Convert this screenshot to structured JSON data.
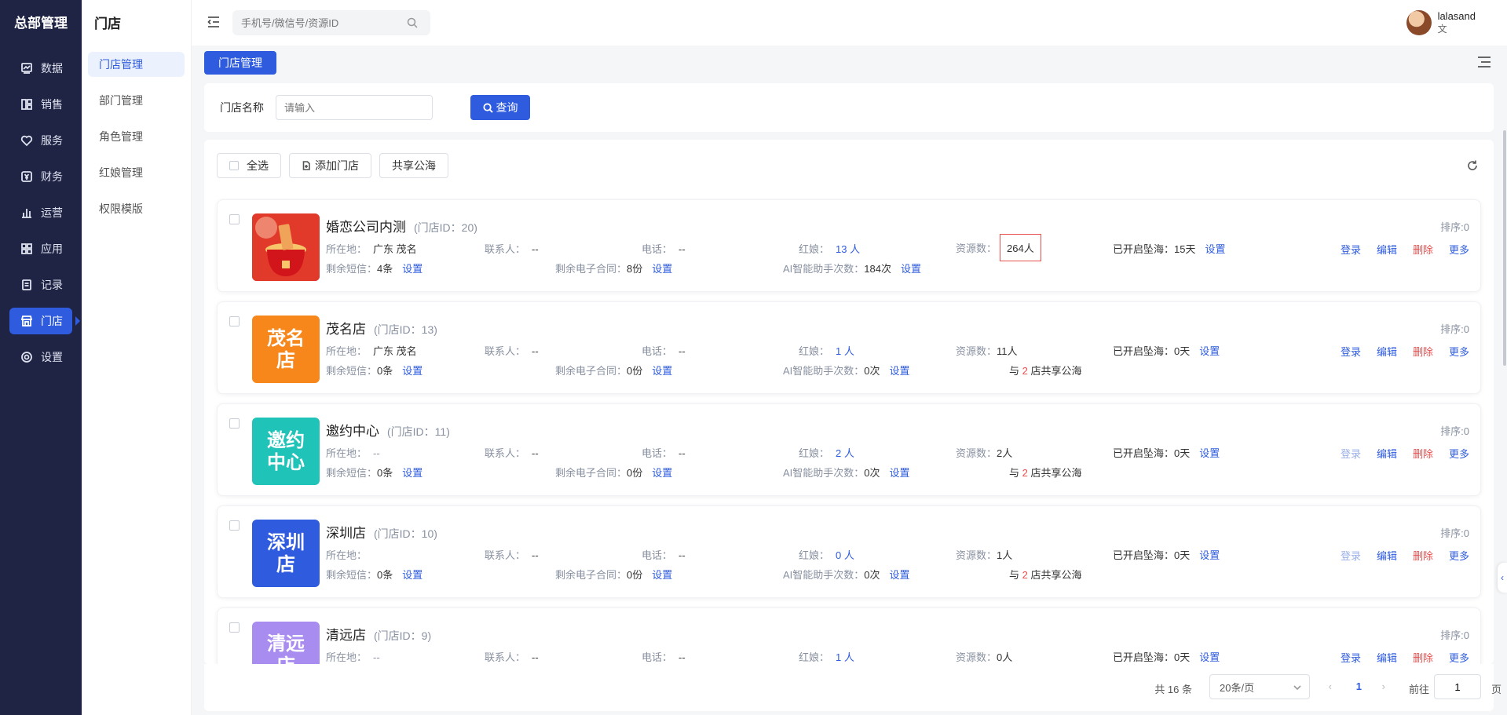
{
  "sidebar": {
    "brand": "总部管理",
    "items": [
      {
        "label": "数据"
      },
      {
        "label": "销售"
      },
      {
        "label": "服务"
      },
      {
        "label": "财务"
      },
      {
        "label": "运营"
      },
      {
        "label": "应用"
      },
      {
        "label": "记录"
      },
      {
        "label": "门店"
      },
      {
        "label": "设置"
      }
    ]
  },
  "submenu": {
    "title": "门店",
    "items": [
      {
        "label": "门店管理"
      },
      {
        "label": "部门管理"
      },
      {
        "label": "角色管理"
      },
      {
        "label": "红娘管理"
      },
      {
        "label": "权限模版"
      }
    ]
  },
  "header": {
    "search_placeholder": "手机号/微信号/资源ID",
    "user_name": "lalasand",
    "user_role": "文"
  },
  "tab": {
    "label": "门店管理"
  },
  "filter": {
    "name_label": "门店名称",
    "name_placeholder": "请输入",
    "query_label": "查询"
  },
  "toolbar": {
    "select_all": "全选",
    "add_store": "添加门店",
    "shared_pool": "共享公海"
  },
  "labels": {
    "id_prefix": "(门店ID：",
    "id_suffix": ")",
    "sort": "排序:0",
    "location": "所在地：",
    "contact": "联系人：",
    "phone": "电话：",
    "matchmaker": "红娘：",
    "resources": "资源数：",
    "pool_open": "已开启坠海：",
    "sms": "剩余短信：",
    "contracts": "剩余电子合同：",
    "ai": "AI智能助手次数：",
    "set": "设置",
    "share_prefix": "与",
    "share_suffix": "店共享公海",
    "login": "登录",
    "edit": "编辑",
    "delete": "删除",
    "more": "更多"
  },
  "stores": [
    {
      "name": "婚恋公司内测",
      "id": "20",
      "location": "广东    茂名",
      "contact": "--",
      "phone": "--",
      "matchmaker": "13 人",
      "resources": "264人",
      "pool_days": "15天",
      "sms": "4条",
      "contracts": "8份",
      "ai": "184次",
      "share_count": "",
      "logo_text": ""
    },
    {
      "name": "茂名店",
      "id": "13",
      "location": "广东    茂名",
      "contact": "--",
      "phone": "--",
      "matchmaker": "1 人",
      "resources": "11人",
      "pool_days": "0天",
      "sms": "0条",
      "contracts": "0份",
      "ai": "0次",
      "share_count": "2",
      "logo_text": "茂名店"
    },
    {
      "name": "邀约中心",
      "id": "11",
      "location": "--",
      "contact": "--",
      "phone": "--",
      "matchmaker": "2 人",
      "resources": "2人",
      "pool_days": "0天",
      "sms": "0条",
      "contracts": "0份",
      "ai": "0次",
      "share_count": "2",
      "logo_text": "邀约中心"
    },
    {
      "name": "深圳店",
      "id": "10",
      "location": "",
      "contact": "--",
      "phone": "--",
      "matchmaker": "0 人",
      "resources": "1人",
      "pool_days": "0天",
      "sms": "0条",
      "contracts": "0份",
      "ai": "0次",
      "share_count": "2",
      "logo_text": "深圳店"
    },
    {
      "name": "清远店",
      "id": "9",
      "location": "--",
      "contact": "--",
      "phone": "--",
      "matchmaker": "1 人",
      "resources": "0人",
      "pool_days": "0天",
      "sms": "",
      "contracts": "",
      "ai": "",
      "share_count": "",
      "logo_text": "清远店"
    }
  ],
  "colors": {
    "accent": "#2f5cde",
    "sidebar_bg": "#1f2344",
    "danger": "#e84f4f",
    "logo_maoming": "#f7861b",
    "logo_yaoyue": "#1fc3b8",
    "logo_shenzhen": "#2f5cde",
    "logo_qingyuan": "#a98cf0"
  },
  "pagination": {
    "total": "共 16 条",
    "page_size": "20条/页",
    "current": "1",
    "goto_label": "前往",
    "goto_value": "1",
    "page_unit": "页"
  }
}
